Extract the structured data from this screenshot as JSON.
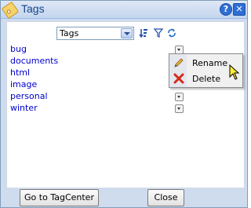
{
  "window": {
    "title": "Tags",
    "help_icon": "help-icon",
    "close_icon": "close-icon"
  },
  "toolbar": {
    "select_value": "Tags",
    "icons": [
      "sort-icon",
      "filter-icon",
      "refresh-icon"
    ]
  },
  "tags": [
    {
      "label": "bug"
    },
    {
      "label": "documents"
    },
    {
      "label": "html"
    },
    {
      "label": "image"
    },
    {
      "label": "personal"
    },
    {
      "label": "winter"
    }
  ],
  "context_menu": {
    "items": [
      {
        "label": "Rename",
        "icon": "pencil-icon"
      },
      {
        "label": "Delete",
        "icon": "delete-icon"
      }
    ]
  },
  "footer": {
    "tagcenter_label": "Go to TagCenter",
    "close_label": "Close"
  },
  "colors": {
    "link": "#0000cc",
    "title": "#15428b",
    "frame": "#cfdcee"
  }
}
